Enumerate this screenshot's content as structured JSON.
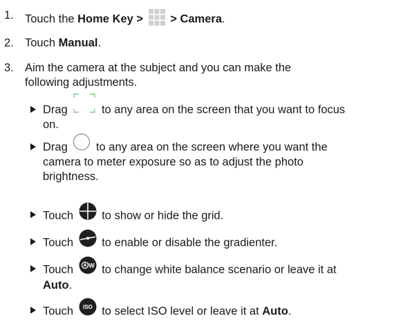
{
  "steps": [
    {
      "num": "1.",
      "parts": [
        "Touch the ",
        "Home Key >",
        " > Camera"
      ],
      "end": "."
    },
    {
      "num": "2.",
      "parts": [
        "Touch ",
        "Manual"
      ],
      "end": "."
    },
    {
      "num": "3.",
      "line1": "Aim the camera at the subject and you can make the",
      "line2": "following adjustments."
    }
  ],
  "bullets": [
    {
      "icon": "focus-frame-icon",
      "pre": "Drag",
      "line1": "to any area on the screen that you want to focus",
      "line2": "on."
    },
    {
      "icon": "exposure-circle-icon",
      "pre": "Drag",
      "line1": "to any area on the screen where you want the",
      "line2": "camera to meter exposure so as to adjust the photo",
      "line3": "brightness."
    },
    {
      "icon": "grid-icon",
      "pre": "Touch",
      "line1": "to show or hide the grid."
    },
    {
      "icon": "gradienter-icon",
      "pre": "Touch",
      "line1": "to enable or disable the gradienter."
    },
    {
      "icon": "white-balance-icon",
      "pre": "Touch",
      "line1": "to change white balance scenario or leave it at",
      "line2_bold": "Auto",
      "line2_end": "."
    },
    {
      "icon": "iso-icon",
      "pre": "Touch",
      "line1": "to select ISO level or leave it at",
      "bold": "Auto",
      "end": ".",
      "icon_label": "ISO",
      "wb_label": "W"
    }
  ]
}
